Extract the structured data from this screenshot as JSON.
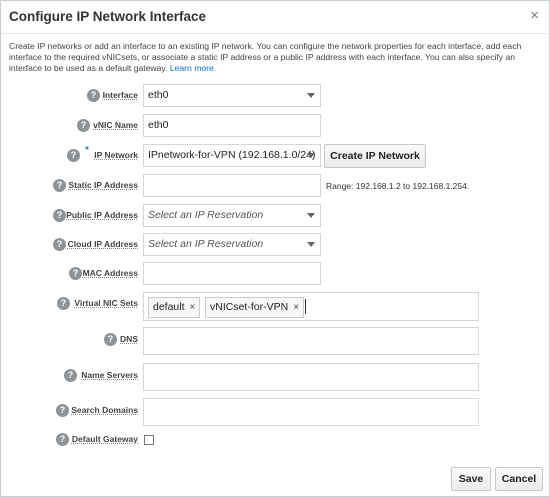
{
  "dialog": {
    "title": "Configure IP Network Interface",
    "close_symbol": "×",
    "description": "Create IP networks or add an interface to an existing IP network. You can configure the network properties for each interface, add each interface to the required vNICsets, or associate a static IP address or a public IP address with each interface. You can also specify an interface to be used as a default gateway.",
    "learn_more": "Learn more."
  },
  "form": {
    "help_symbol": "?",
    "required_symbol": "*",
    "interface": {
      "label": "Interface",
      "value": "eth0"
    },
    "vnic_name": {
      "label": "vNIC Name",
      "value": "eth0"
    },
    "ip_network": {
      "label": "IP Network",
      "value": "IPnetwork-for-VPN (192.168.1.0/24)",
      "button": "Create IP Network"
    },
    "static_ip": {
      "label": "Static IP Address",
      "value": "",
      "hint": "Range: 192.168.1.2 to 192.168.1.254."
    },
    "public_ip": {
      "label": "Public IP Address",
      "placeholder": "Select an IP Reservation"
    },
    "cloud_ip": {
      "label": "Cloud IP Address",
      "placeholder": "Select an IP Reservation"
    },
    "mac": {
      "label": "MAC Address",
      "value": ""
    },
    "vnic_sets": {
      "label": "Virtual NIC Sets",
      "chips": [
        "default",
        "vNICset-for-VPN"
      ],
      "remove_symbol": "×"
    },
    "dns": {
      "label": "DNS",
      "value": ""
    },
    "name_servers": {
      "label": "Name Servers",
      "value": ""
    },
    "search_domains": {
      "label": "Search Domains",
      "value": ""
    },
    "default_gateway": {
      "label": "Default Gateway",
      "checked": false
    }
  },
  "footer": {
    "save": "Save",
    "cancel": "Cancel"
  }
}
